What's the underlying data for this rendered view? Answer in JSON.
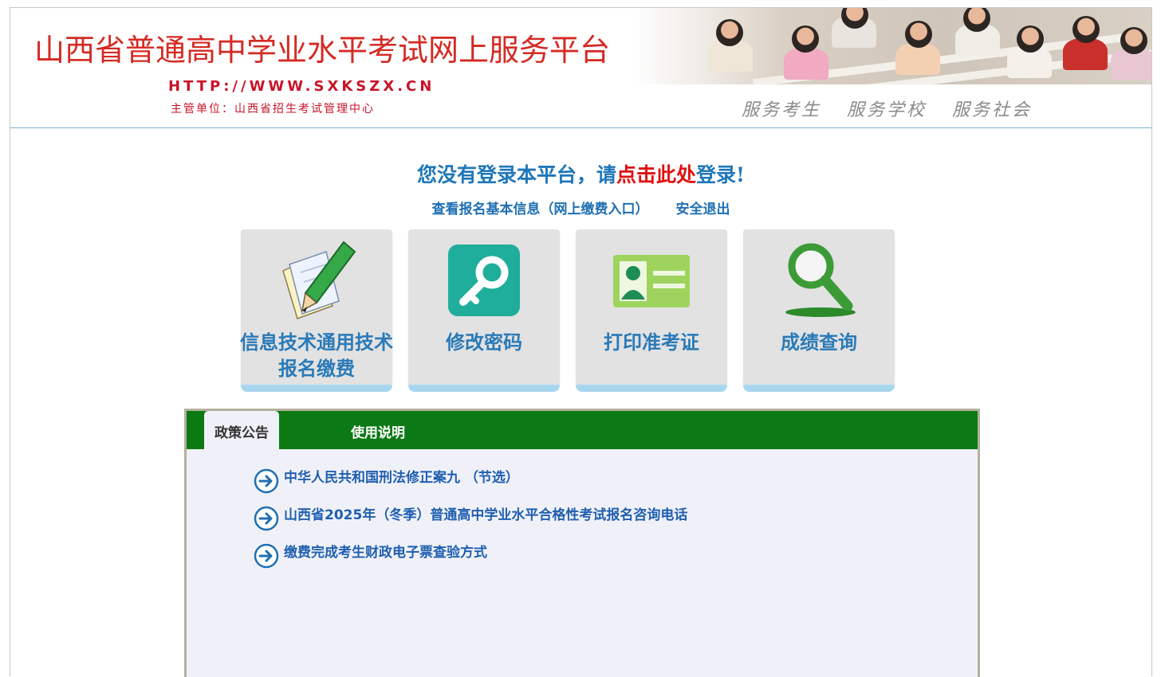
{
  "header": {
    "title": "山西省普通高中学业水平考试网上服务平台",
    "url": "HTTP://WWW.SXKSZX.CN",
    "org": "主管单位：山西省招生考试管理中心",
    "slogans": [
      "服务考生",
      "服务学校",
      "服务社会"
    ]
  },
  "login": {
    "prefix": "您没有登录本平台，请",
    "link": "点击此处",
    "suffix": "登录!",
    "links": [
      "查看报名基本信息（网上缴费入口）",
      "安全退出"
    ]
  },
  "tiles": [
    {
      "line1": "信息技术通用技术",
      "line2": "报名缴费",
      "icon": "pencil-paper-icon"
    },
    {
      "line1": "修改密码",
      "line2": "",
      "icon": "key-icon"
    },
    {
      "line1": "打印准考证",
      "line2": "",
      "icon": "id-card-icon"
    },
    {
      "line1": "成绩查询",
      "line2": "",
      "icon": "magnifier-icon"
    }
  ],
  "tabs": [
    {
      "label": "政策公告",
      "active": true
    },
    {
      "label": "使用说明",
      "active": false
    }
  ],
  "notices": [
    "中华人民共和国刑法修正案九 （节选）",
    "山西省2025年（冬季）普通高中学业水平合格性考试报名咨询电话",
    "缴费完成考生财政电子票查验方式"
  ],
  "colors": {
    "title_red": "#d42a23",
    "link_blue": "#1f77b9",
    "highlight_red": "#e01010",
    "tab_green": "#0c7a14",
    "tile_bar": "#a8d6ef"
  }
}
